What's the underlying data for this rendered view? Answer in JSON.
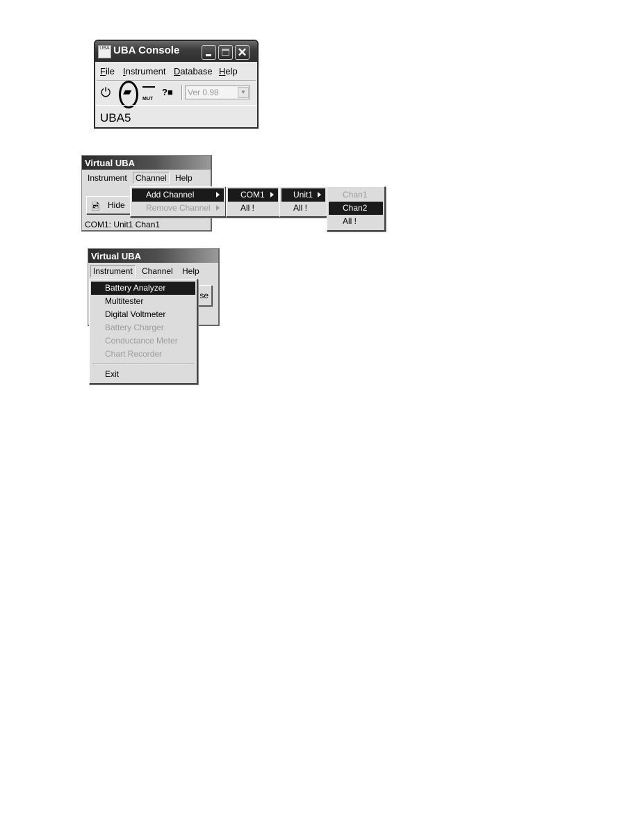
{
  "uba_console": {
    "title": "UBA Console",
    "title_icon_text": "UBA",
    "window_controls": {
      "minimize": "minimize",
      "maximize": "maximize",
      "close": "✕"
    },
    "menu": [
      {
        "label": "File",
        "accel": "F"
      },
      {
        "label": "Instrument",
        "accel": "I"
      },
      {
        "label": "Database",
        "accel": "D"
      },
      {
        "label": "Help",
        "accel": "H"
      }
    ],
    "toolbar": {
      "power_icon": "⏻",
      "battery_analyzer_icon": "▰",
      "multitester_icon": "MUT",
      "help_icon": "?■",
      "version_value": "Ver 0.98",
      "dropdown_arrow": "▼"
    },
    "instrument_label": "UBA5"
  },
  "virtual_uba_channel": {
    "title": "Virtual UBA",
    "menu": [
      "Instrument",
      "Channel",
      "Help"
    ],
    "hide_button": {
      "icon": "🖻",
      "label": "Hide"
    },
    "status": "COM1: Unit1 Chan1",
    "channel_menu": [
      {
        "label": "Add Channel",
        "highlighted": true,
        "disabled": false,
        "submenu": true
      },
      {
        "label": "Remove Channel",
        "highlighted": false,
        "disabled": true,
        "submenu": true
      }
    ],
    "com_menu": [
      {
        "label": "COM1",
        "highlighted": true,
        "submenu": true
      },
      {
        "label": "All !",
        "highlighted": false,
        "submenu": false
      }
    ],
    "unit_menu": [
      {
        "label": "Unit1",
        "highlighted": true,
        "submenu": true
      },
      {
        "label": "All !",
        "highlighted": false,
        "submenu": false
      }
    ],
    "chan_menu": [
      {
        "label": "Chan1",
        "highlighted": false,
        "disabled": true
      },
      {
        "label": "Chan2",
        "highlighted": true,
        "disabled": false
      },
      {
        "label": "All !",
        "highlighted": false,
        "disabled": false
      }
    ]
  },
  "virtual_uba_instrument": {
    "title": "Virtual UBA",
    "menu": [
      "Instrument",
      "Channel",
      "Help"
    ],
    "partial_button_text": "se",
    "instrument_menu": [
      {
        "label": "Battery Analyzer",
        "highlighted": true,
        "disabled": false
      },
      {
        "label": "Multitester",
        "highlighted": false,
        "disabled": false
      },
      {
        "label": "Digital Voltmeter",
        "highlighted": false,
        "disabled": false
      },
      {
        "label": "Battery Charger",
        "highlighted": false,
        "disabled": true
      },
      {
        "label": "Conductance Meter",
        "highlighted": false,
        "disabled": true
      },
      {
        "label": "Chart Recorder",
        "highlighted": false,
        "disabled": true
      },
      {
        "label": "Exit",
        "highlighted": false,
        "disabled": false
      }
    ]
  }
}
